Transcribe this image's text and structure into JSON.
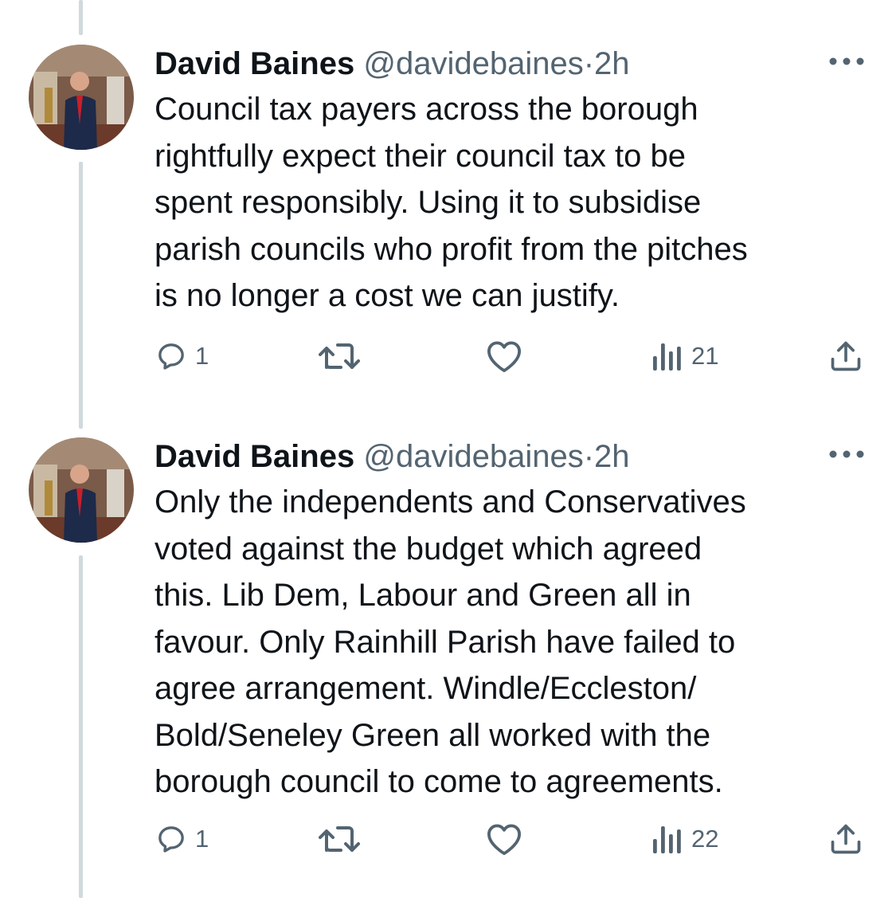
{
  "tweets": [
    {
      "author_name": "David Baines",
      "handle": "@davidebaines",
      "separator": "·",
      "time": "2h",
      "text": "Council tax payers across the borough\nrightfully expect their council tax to be\nspent responsibly. Using it to subsidise\nparish councils who profit from the pitches\nis no longer a cost we can justify.",
      "reply_count": "1",
      "views_count": "21"
    },
    {
      "author_name": "David Baines",
      "handle": "@davidebaines",
      "separator": "·",
      "time": "2h",
      "text": "Only the independents and Conservatives\nvoted against the budget which agreed\nthis. Lib Dem, Labour and Green all in\nfavour. Only Rainhill Parish have failed to\nagree arrangement. Windle/Eccleston/\nBold/Seneley Green all worked with the\nborough council to come to agreements.",
      "reply_count": "1",
      "views_count": "22"
    }
  ],
  "icons": {
    "more": "more-horizontal-icon",
    "reply": "reply-bubble-icon",
    "retweet": "retweet-icon",
    "like": "heart-icon",
    "views": "views-chart-icon",
    "share": "share-upload-icon"
  },
  "colors": {
    "text": "#0f1419",
    "secondary": "#536471",
    "thread_line": "#cfd9de"
  }
}
